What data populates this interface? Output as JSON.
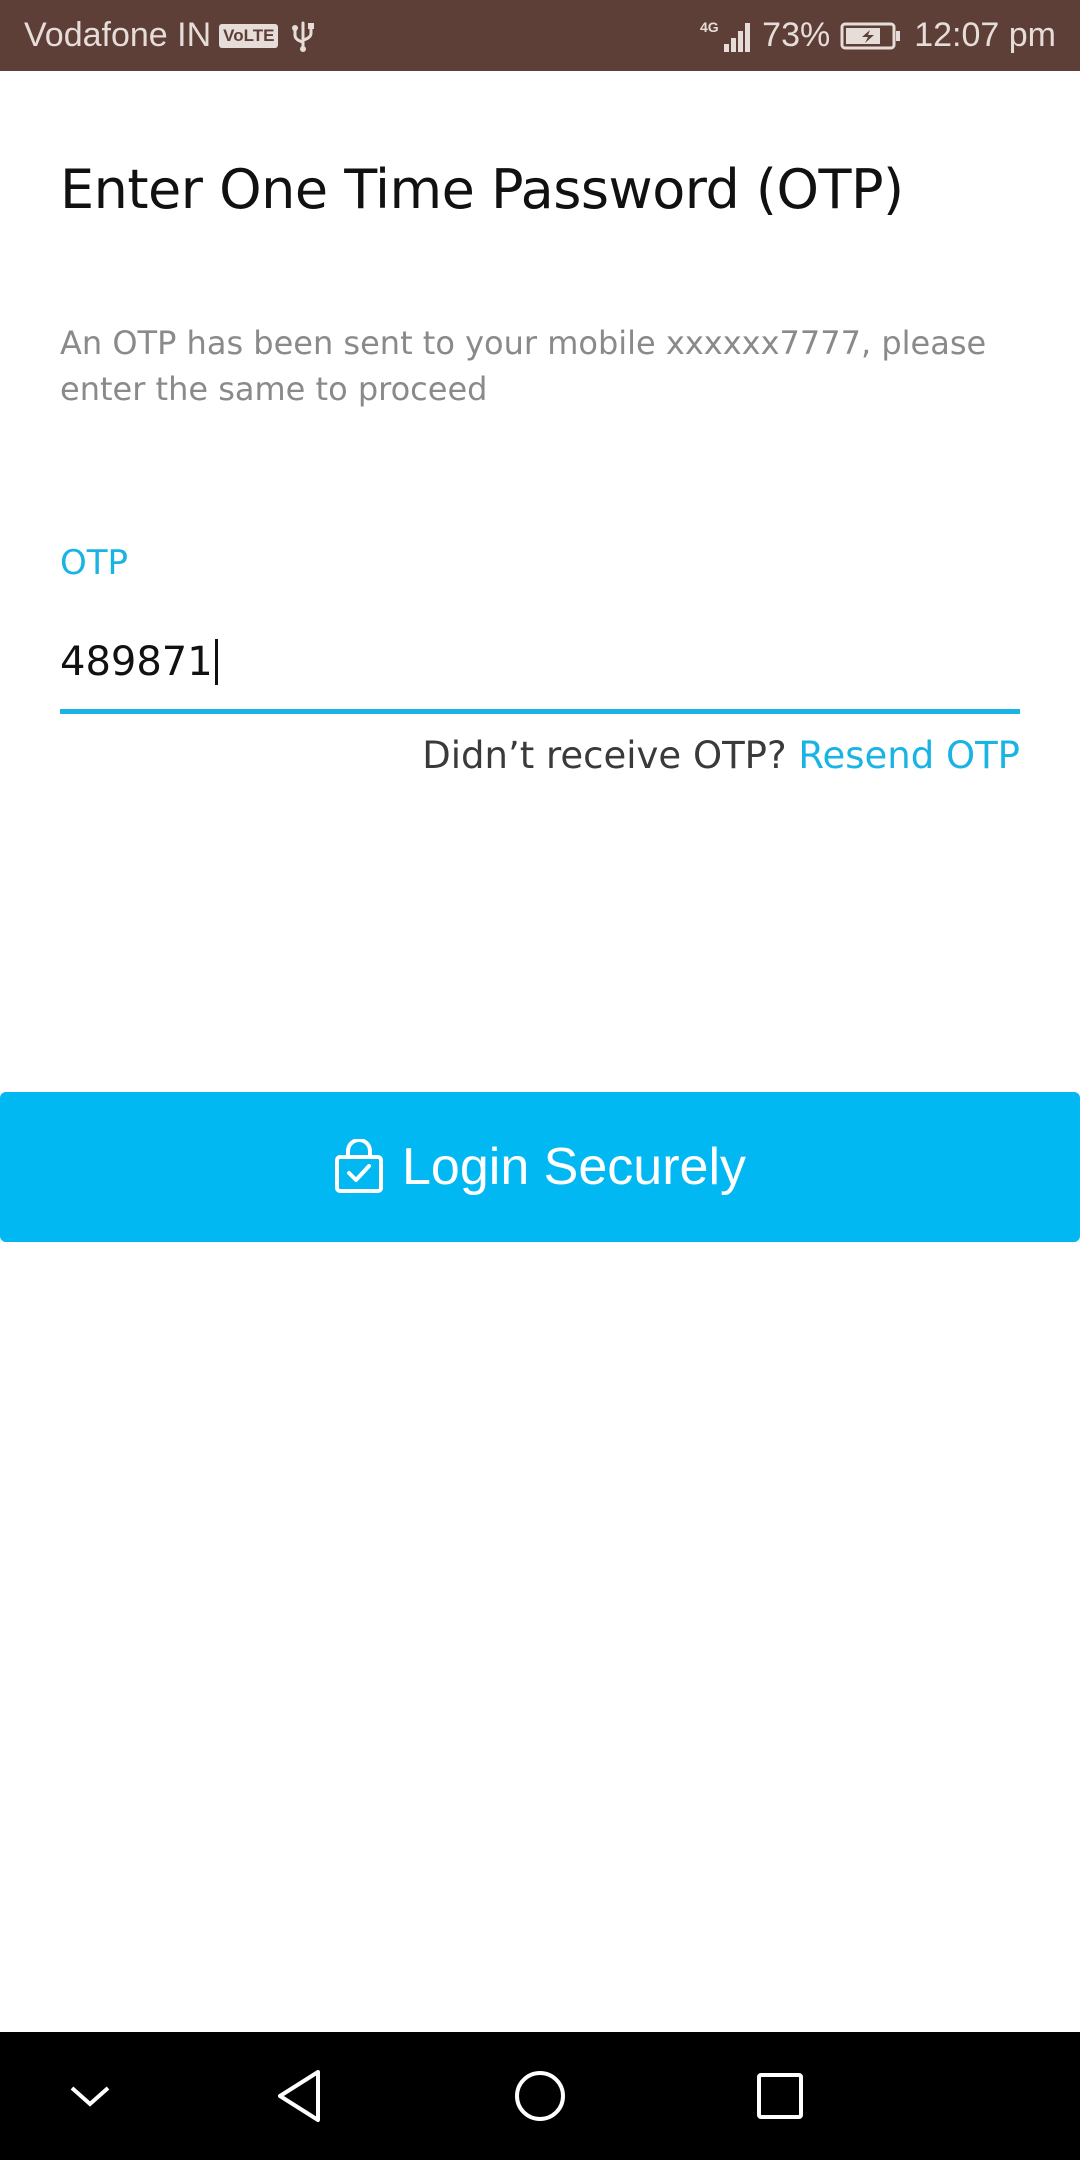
{
  "status_bar": {
    "carrier": "Vodafone IN",
    "volte": "VoLTE",
    "network": "4G",
    "battery": "73%",
    "time": "12:07 pm",
    "background": "#5d3f37"
  },
  "screen": {
    "title": "Enter One Time Password (OTP)",
    "description": "An OTP has been sent to your mobile xxxxxx7777, please enter the same to proceed",
    "otp_label": "OTP",
    "otp_value": "489871",
    "resend_prompt": "Didn’t receive OTP?",
    "resend_link": "Resend OTP",
    "accent_color": "#19b4e3"
  },
  "login_button": {
    "label": "Login Securely",
    "icon": "lock-check-icon",
    "color": "#02b8f2"
  },
  "nav_bar": {
    "icons": [
      "chevron-down-icon",
      "back-icon",
      "home-icon",
      "recents-icon"
    ]
  }
}
